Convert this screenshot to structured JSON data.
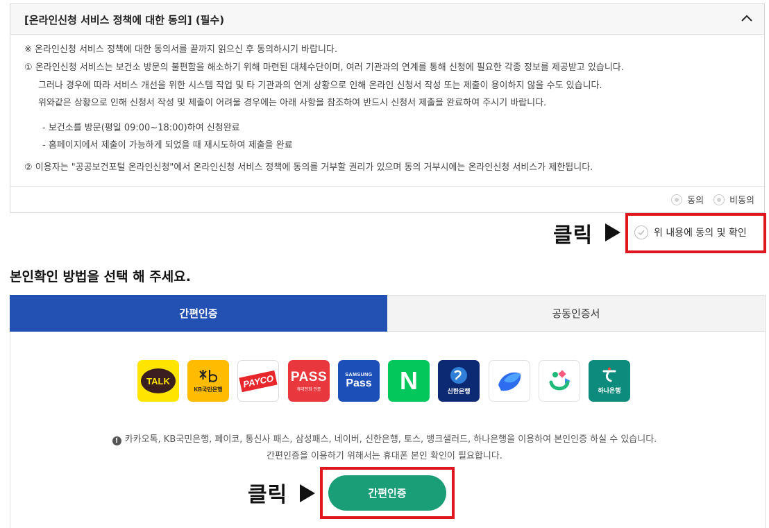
{
  "policy": {
    "title": "[온라인신청 서비스 정책에 대한 동의] (필수)",
    "lines": [
      "※ 온라인신청 서비스 정책에 대한 동의서를 끝까지 읽으신 후 동의하시기 바랍니다.",
      "①  온라인신청 서비스는 보건소 방문의 불편함을 해소하기 위해 마련된 대체수단이며, 여러 기관과의 연계를 통해 신청에 필요한 각종 정보를 제공받고 있습니다.",
      "그러나 경우에 따라 서비스 개선을 위한 시스템 작업 및 타 기관과의 연계 상황으로 인해 온라인 신청서 작성 또는 제출이 용이하지 않을 수도 있습니다.",
      "위와같은 상황으로 인해 신청서 작성 및 제출이 어려울 경우에는 아래 사항을 참조하여 반드시 신청서 제출을 완료하여 주시기 바랍니다.",
      "-  보건소를 방문(평일 09:00~18:00)하여 신청완료",
      "-  홈페이지에서 제출이 가능하게 되었을 때 재시도하여 제출을 완료",
      "②  이용자는 \"공공보건포털 온라인신청\"에서 온라인신청 서비스 정책에 동의를 거부할 권리가 있으며 동의 거부시에는 온라인신청 서비스가 제한됩니다."
    ],
    "agree_label": "동의",
    "disagree_label": "비동의"
  },
  "annotations": {
    "click_label": "클릭"
  },
  "confirm": {
    "label": "위 내용에 동의 및 확인"
  },
  "section_title": "본인확인 방법을 선택 해 주세요.",
  "tabs": [
    {
      "label": "간편인증",
      "active": true
    },
    {
      "label": "공동인증서",
      "active": false
    }
  ],
  "providers": [
    {
      "name": "카카오톡",
      "text": "TALK",
      "icon": "kakao-talk-icon",
      "bg": "#fee500"
    },
    {
      "name": "KB국민은행",
      "text": "KB국민은행",
      "icon": "kb-bank-icon",
      "bg": "#ffbc00"
    },
    {
      "name": "페이코",
      "text": "PAYCO",
      "icon": "payco-icon",
      "bg": "#ffffff"
    },
    {
      "name": "통신사 패스",
      "text": "PASS",
      "subtext": "휴대전화 인증",
      "icon": "pass-icon",
      "bg": "#e8383d"
    },
    {
      "name": "삼성패스",
      "text": "Pass",
      "subtext": "SAMSUNG",
      "icon": "samsung-pass-icon",
      "bg": "#1d4fb8"
    },
    {
      "name": "네이버",
      "text": "N",
      "icon": "naver-icon",
      "bg": "#03c75a"
    },
    {
      "name": "신한은행",
      "text": "신한은행",
      "icon": "shinhan-bank-icon",
      "bg": "#0c2a73"
    },
    {
      "name": "토스",
      "text": "",
      "icon": "toss-icon",
      "bg": "#ffffff"
    },
    {
      "name": "뱅크샐러드",
      "text": "",
      "icon": "banksalad-icon",
      "bg": "#ffffff"
    },
    {
      "name": "하나은행",
      "text": "하나은행",
      "icon": "hana-bank-icon",
      "bg": "#0d8b7d"
    }
  ],
  "notes": {
    "line1": "카카오톡, KB국민은행, 페이코, 통신사 패스, 삼성패스, 네이버, 신한은행, 토스, 뱅크샐러드, 하나은행을 이용하여 본인인증 하실 수 있습니다.",
    "line2": "간편인증을 이용하기 위해서는 휴대폰 본인 확인이 필요합니다."
  },
  "auth_button": {
    "label": "간편인증"
  },
  "colors": {
    "tab_active": "#2350b3",
    "auth_button": "#1a9e77",
    "annotation_red": "#e0171f"
  }
}
